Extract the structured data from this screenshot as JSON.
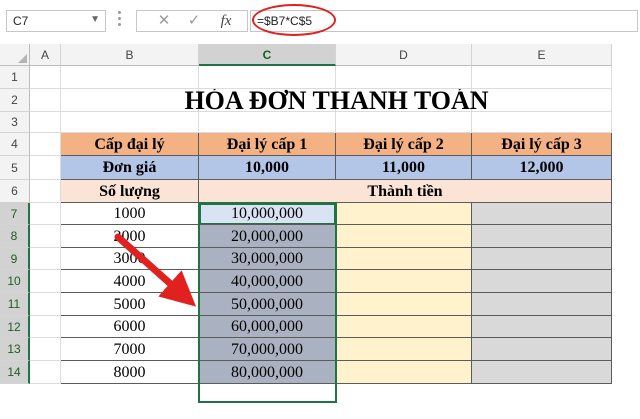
{
  "name_box": {
    "value": "C7"
  },
  "formula_bar": {
    "cancel_glyph": "✕",
    "enter_glyph": "✓",
    "fx_label": "fx",
    "formula": "=$B7*C$5"
  },
  "columns": [
    "A",
    "B",
    "C",
    "D",
    "E"
  ],
  "rows": [
    "1",
    "2",
    "3",
    "4",
    "5",
    "6",
    "7",
    "8",
    "9",
    "10",
    "11",
    "12",
    "13",
    "14"
  ],
  "sheet": {
    "title": "HÓA ĐƠN THANH TOÁN",
    "header_row": [
      "Cấp đại lý",
      "Đại lý cấp 1",
      "Đại lý cấp 2",
      "Đại lý cấp 3"
    ],
    "price_row": [
      "Đơn giá",
      "10,000",
      "11,000",
      "12,000"
    ],
    "qty_label": "Số lượng",
    "amount_label": "Thành tiền",
    "quantities": [
      "1000",
      "2000",
      "3000",
      "4000",
      "5000",
      "6000",
      "7000",
      "8000"
    ],
    "amounts_c": [
      "10,000,000",
      "20,000,000",
      "30,000,000",
      "40,000,000",
      "50,000,000",
      "60,000,000",
      "70,000,000",
      "80,000,000"
    ]
  },
  "colors": {
    "header_fill": "#f4b184",
    "price_fill": "#b4c6e7",
    "label_fill": "#fbe3d6",
    "col_d_fill": "#fff2cc",
    "col_e_fill": "#d9d9d9",
    "selection_fill": "#aab1c0",
    "selection_border": "#217346",
    "annotation_red": "#e0211f"
  },
  "icons": {
    "name_box_dropdown": "chevron-down-icon",
    "cancel": "close-icon",
    "enter": "check-icon",
    "function": "fx-icon",
    "annotation": "arrow-icon"
  }
}
